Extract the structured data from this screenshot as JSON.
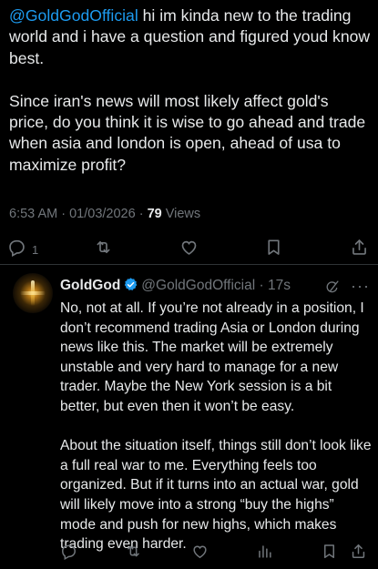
{
  "post": {
    "mention": "@GoldGodOfficial",
    "text_after_mention": " hi im kinda new to the trading world and i have a question and figured youd know best.\n\nSince iran's news will most likely affect gold's price, do you think it is wise to go ahead and trade when asia and london is open, ahead of usa to maximize profit?",
    "time": "6:53 AM",
    "date": "01/03/2026",
    "views_count": "79",
    "views_label": "Views",
    "reply_count": "1"
  },
  "reply": {
    "display_name": "GoldGod",
    "handle": "@GoldGodOfficial",
    "time_ago": "17s",
    "text": "No, not at all. If you’re not already in a position, I don’t recommend trading Asia or London during news like this. The market will be extremely unstable and very hard to manage for a new trader. Maybe the New York session is a bit better, but even then it won’t be easy.\n\nAbout the situation itself, things still don’t look like a full real war to me. Everything feels too organized. But if it turns into an actual war, gold will likely move into a strong “buy the highs” mode and push for new highs, which makes trading even harder."
  },
  "colors": {
    "background": "#000000",
    "text": "#e7e9ea",
    "muted": "#71767b",
    "accent": "#1d9bf0",
    "divider": "#2f3336"
  },
  "icons": [
    "reply-icon",
    "retweet-icon",
    "like-icon",
    "bookmark-icon",
    "share-icon",
    "verified-badge-icon",
    "grok-icon",
    "more-icon",
    "views-icon"
  ]
}
